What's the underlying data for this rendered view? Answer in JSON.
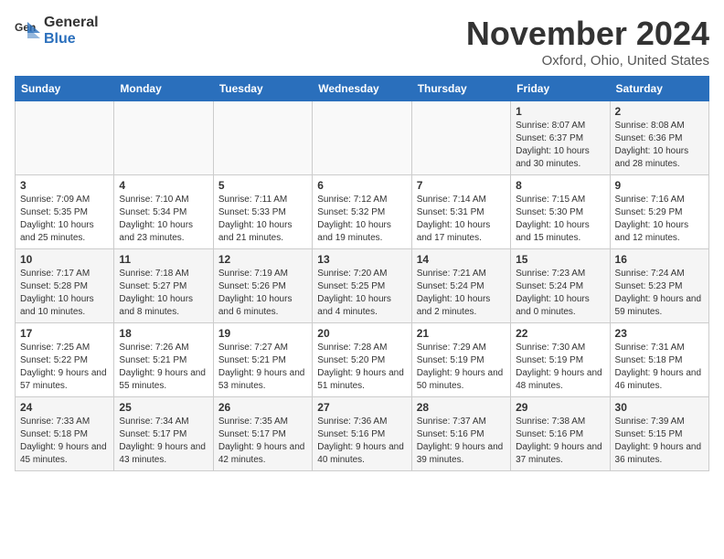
{
  "header": {
    "logo_general": "General",
    "logo_blue": "Blue",
    "month_title": "November 2024",
    "location": "Oxford, Ohio, United States"
  },
  "days_of_week": [
    "Sunday",
    "Monday",
    "Tuesday",
    "Wednesday",
    "Thursday",
    "Friday",
    "Saturday"
  ],
  "weeks": [
    [
      {
        "day": "",
        "info": ""
      },
      {
        "day": "",
        "info": ""
      },
      {
        "day": "",
        "info": ""
      },
      {
        "day": "",
        "info": ""
      },
      {
        "day": "",
        "info": ""
      },
      {
        "day": "1",
        "info": "Sunrise: 8:07 AM\nSunset: 6:37 PM\nDaylight: 10 hours and 30 minutes."
      },
      {
        "day": "2",
        "info": "Sunrise: 8:08 AM\nSunset: 6:36 PM\nDaylight: 10 hours and 28 minutes."
      }
    ],
    [
      {
        "day": "3",
        "info": "Sunrise: 7:09 AM\nSunset: 5:35 PM\nDaylight: 10 hours and 25 minutes."
      },
      {
        "day": "4",
        "info": "Sunrise: 7:10 AM\nSunset: 5:34 PM\nDaylight: 10 hours and 23 minutes."
      },
      {
        "day": "5",
        "info": "Sunrise: 7:11 AM\nSunset: 5:33 PM\nDaylight: 10 hours and 21 minutes."
      },
      {
        "day": "6",
        "info": "Sunrise: 7:12 AM\nSunset: 5:32 PM\nDaylight: 10 hours and 19 minutes."
      },
      {
        "day": "7",
        "info": "Sunrise: 7:14 AM\nSunset: 5:31 PM\nDaylight: 10 hours and 17 minutes."
      },
      {
        "day": "8",
        "info": "Sunrise: 7:15 AM\nSunset: 5:30 PM\nDaylight: 10 hours and 15 minutes."
      },
      {
        "day": "9",
        "info": "Sunrise: 7:16 AM\nSunset: 5:29 PM\nDaylight: 10 hours and 12 minutes."
      }
    ],
    [
      {
        "day": "10",
        "info": "Sunrise: 7:17 AM\nSunset: 5:28 PM\nDaylight: 10 hours and 10 minutes."
      },
      {
        "day": "11",
        "info": "Sunrise: 7:18 AM\nSunset: 5:27 PM\nDaylight: 10 hours and 8 minutes."
      },
      {
        "day": "12",
        "info": "Sunrise: 7:19 AM\nSunset: 5:26 PM\nDaylight: 10 hours and 6 minutes."
      },
      {
        "day": "13",
        "info": "Sunrise: 7:20 AM\nSunset: 5:25 PM\nDaylight: 10 hours and 4 minutes."
      },
      {
        "day": "14",
        "info": "Sunrise: 7:21 AM\nSunset: 5:24 PM\nDaylight: 10 hours and 2 minutes."
      },
      {
        "day": "15",
        "info": "Sunrise: 7:23 AM\nSunset: 5:24 PM\nDaylight: 10 hours and 0 minutes."
      },
      {
        "day": "16",
        "info": "Sunrise: 7:24 AM\nSunset: 5:23 PM\nDaylight: 9 hours and 59 minutes."
      }
    ],
    [
      {
        "day": "17",
        "info": "Sunrise: 7:25 AM\nSunset: 5:22 PM\nDaylight: 9 hours and 57 minutes."
      },
      {
        "day": "18",
        "info": "Sunrise: 7:26 AM\nSunset: 5:21 PM\nDaylight: 9 hours and 55 minutes."
      },
      {
        "day": "19",
        "info": "Sunrise: 7:27 AM\nSunset: 5:21 PM\nDaylight: 9 hours and 53 minutes."
      },
      {
        "day": "20",
        "info": "Sunrise: 7:28 AM\nSunset: 5:20 PM\nDaylight: 9 hours and 51 minutes."
      },
      {
        "day": "21",
        "info": "Sunrise: 7:29 AM\nSunset: 5:19 PM\nDaylight: 9 hours and 50 minutes."
      },
      {
        "day": "22",
        "info": "Sunrise: 7:30 AM\nSunset: 5:19 PM\nDaylight: 9 hours and 48 minutes."
      },
      {
        "day": "23",
        "info": "Sunrise: 7:31 AM\nSunset: 5:18 PM\nDaylight: 9 hours and 46 minutes."
      }
    ],
    [
      {
        "day": "24",
        "info": "Sunrise: 7:33 AM\nSunset: 5:18 PM\nDaylight: 9 hours and 45 minutes."
      },
      {
        "day": "25",
        "info": "Sunrise: 7:34 AM\nSunset: 5:17 PM\nDaylight: 9 hours and 43 minutes."
      },
      {
        "day": "26",
        "info": "Sunrise: 7:35 AM\nSunset: 5:17 PM\nDaylight: 9 hours and 42 minutes."
      },
      {
        "day": "27",
        "info": "Sunrise: 7:36 AM\nSunset: 5:16 PM\nDaylight: 9 hours and 40 minutes."
      },
      {
        "day": "28",
        "info": "Sunrise: 7:37 AM\nSunset: 5:16 PM\nDaylight: 9 hours and 39 minutes."
      },
      {
        "day": "29",
        "info": "Sunrise: 7:38 AM\nSunset: 5:16 PM\nDaylight: 9 hours and 37 minutes."
      },
      {
        "day": "30",
        "info": "Sunrise: 7:39 AM\nSunset: 5:15 PM\nDaylight: 9 hours and 36 minutes."
      }
    ]
  ]
}
